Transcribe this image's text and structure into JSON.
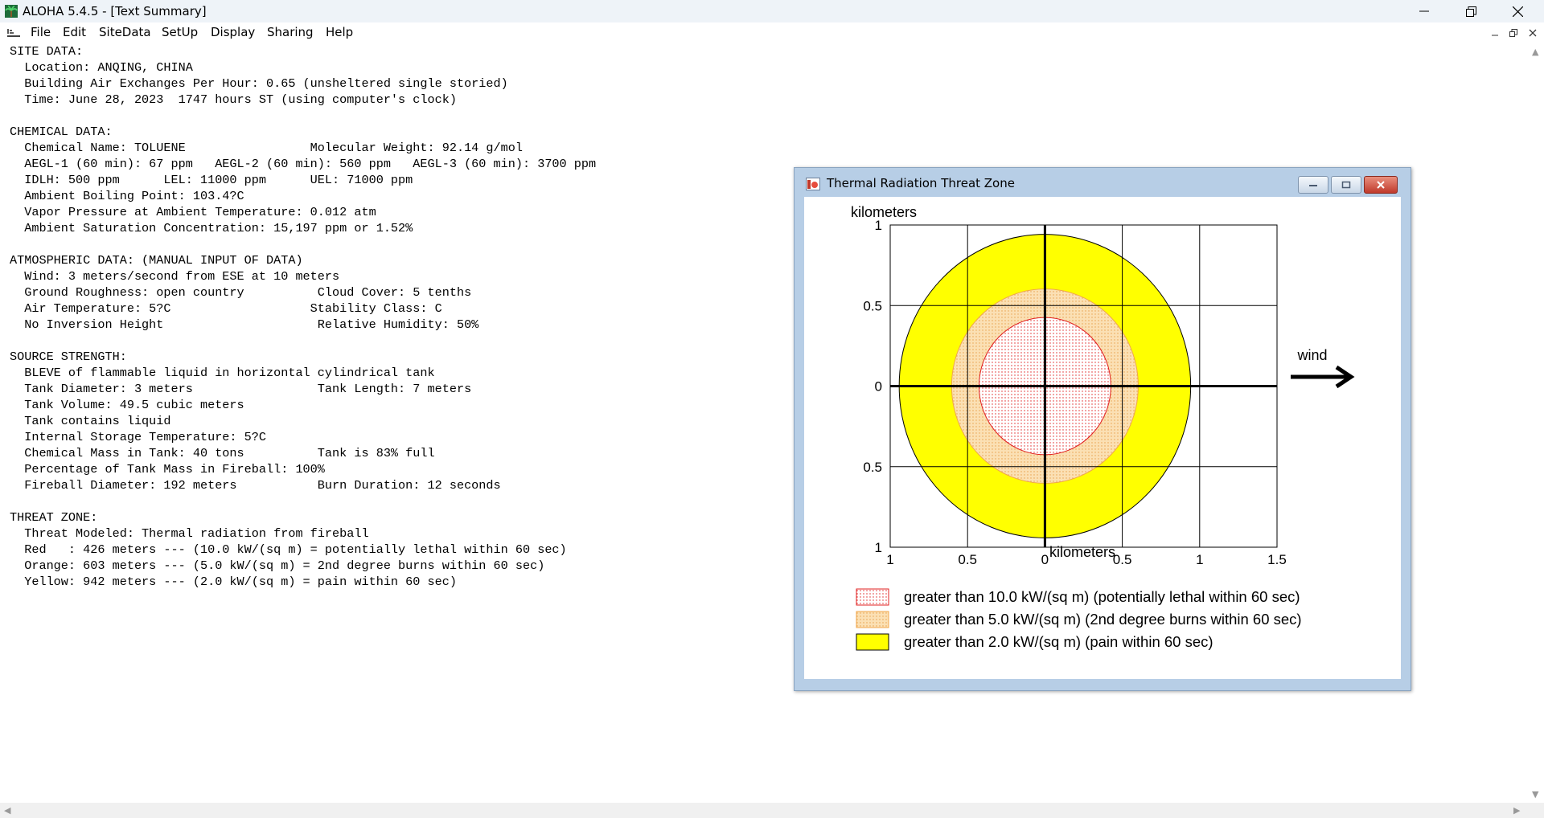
{
  "window": {
    "title": "ALOHA 5.4.5 - [Text Summary]",
    "icons": {
      "app": "palm-tree-icon",
      "minimize": "minimize-icon",
      "restore": "restore-icon",
      "close": "close-icon"
    }
  },
  "menu": {
    "items": [
      "File",
      "Edit",
      "SiteData",
      "SetUp",
      "Display",
      "Sharing",
      "Help"
    ]
  },
  "summary": {
    "lines": [
      "SITE DATA:",
      "  Location: ANQING, CHINA",
      "  Building Air Exchanges Per Hour: 0.65 (unsheltered single storied)",
      "  Time: June 28, 2023  1747 hours ST (using computer's clock)",
      "",
      "CHEMICAL DATA:",
      "  Chemical Name: TOLUENE                 Molecular Weight: 92.14 g/mol",
      "  AEGL-1 (60 min): 67 ppm   AEGL-2 (60 min): 560 ppm   AEGL-3 (60 min): 3700 ppm",
      "  IDLH: 500 ppm      LEL: 11000 ppm      UEL: 71000 ppm",
      "  Ambient Boiling Point: 103.4?C",
      "  Vapor Pressure at Ambient Temperature: 0.012 atm",
      "  Ambient Saturation Concentration: 15,197 ppm or 1.52%",
      "",
      "ATMOSPHERIC DATA: (MANUAL INPUT OF DATA)",
      "  Wind: 3 meters/second from ESE at 10 meters",
      "  Ground Roughness: open country          Cloud Cover: 5 tenths",
      "  Air Temperature: 5?C                   Stability Class: C",
      "  No Inversion Height                     Relative Humidity: 50%",
      "",
      "SOURCE STRENGTH:",
      "  BLEVE of flammable liquid in horizontal cylindrical tank",
      "  Tank Diameter: 3 meters                 Tank Length: 7 meters",
      "  Tank Volume: 49.5 cubic meters",
      "  Tank contains liquid",
      "  Internal Storage Temperature: 5?C",
      "  Chemical Mass in Tank: 40 tons          Tank is 83% full",
      "  Percentage of Tank Mass in Fireball: 100%",
      "  Fireball Diameter: 192 meters           Burn Duration: 12 seconds",
      "",
      "THREAT ZONE:",
      "  Threat Modeled: Thermal radiation from fireball",
      "  Red   : 426 meters --- (10.0 kW/(sq m) = potentially lethal within 60 sec)",
      "  Orange: 603 meters --- (5.0 kW/(sq m) = 2nd degree burns within 60 sec)",
      "  Yellow: 942 meters --- (2.0 kW/(sq m) = pain within 60 sec)"
    ]
  },
  "threat_window": {
    "title": "Thermal Radiation Threat Zone",
    "icons": {
      "app": "chart-window-icon",
      "minimize": "minimize-icon",
      "maximize": "maximize-icon",
      "close": "close-icon"
    },
    "wind_label": "wind"
  },
  "chart_data": {
    "type": "threat-zone",
    "title": "",
    "xlabel": "kilometers",
    "ylabel": "kilometers",
    "xlim": [
      -1,
      1.5
    ],
    "ylim": [
      -1,
      1
    ],
    "x_ticks": [
      -1,
      -0.5,
      0,
      0.5,
      1,
      1.5
    ],
    "x_tick_labels": [
      "1",
      "0.5",
      "0",
      "0.5",
      "1",
      "1.5"
    ],
    "y_ticks": [
      1,
      0.5,
      0,
      -0.5,
      -1
    ],
    "y_tick_labels": [
      "1",
      "0.5",
      "0",
      "0.5",
      "1"
    ],
    "grid": true,
    "wind_direction": "east",
    "zones": [
      {
        "name": "greater than 2.0 kW/(sq m) (pain within 60 sec)",
        "radius_km": 0.942,
        "fill": "#ffff00",
        "stroke": "#000000",
        "pattern": "solid"
      },
      {
        "name": "greater than 5.0 kW/(sq m) (2nd degree burns within 60 sec)",
        "radius_km": 0.603,
        "fill": "#fbe0b4",
        "stroke": "#f0a64a",
        "pattern": "dots"
      },
      {
        "name": "greater than 10.0 kW/(sq m) (potentially lethal within 60 sec)",
        "radius_km": 0.426,
        "fill": "#ffffff",
        "stroke": "#e02020",
        "pattern": "dots"
      }
    ],
    "legend": [
      {
        "label": "greater than 10.0 kW/(sq m) (potentially lethal within 60 sec)",
        "fill": "#ffffff",
        "stroke": "#e02020",
        "pattern": "dots"
      },
      {
        "label": "greater than 5.0 kW/(sq m) (2nd degree burns within 60 sec)",
        "fill": "#fbe0b4",
        "stroke": "#f0a64a",
        "pattern": "dots"
      },
      {
        "label": "greater than 2.0 kW/(sq m) (pain within 60 sec)",
        "fill": "#ffff00",
        "stroke": "#000000",
        "pattern": "solid"
      }
    ]
  }
}
